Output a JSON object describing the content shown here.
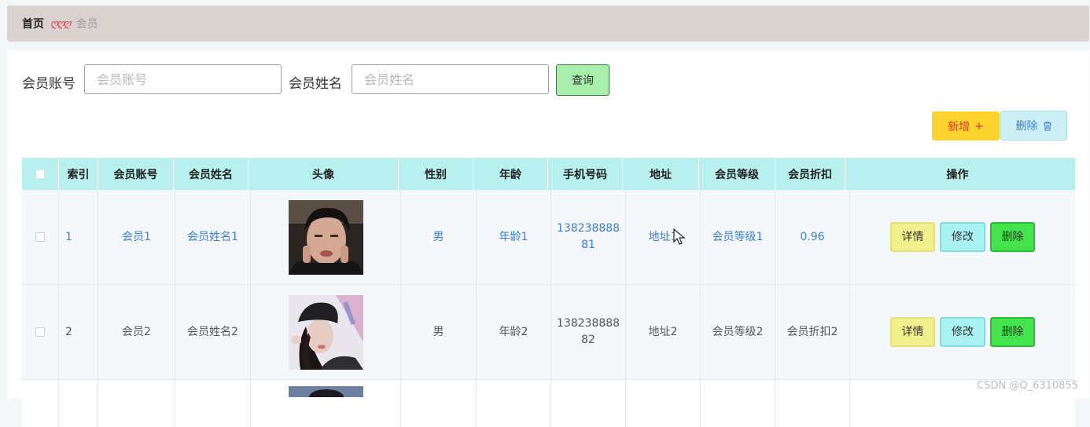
{
  "breadcrumb": {
    "home": "首页",
    "separator": "ღღღ",
    "current": "会员"
  },
  "search": {
    "account_label": "会员账号",
    "account_placeholder": "会员账号",
    "name_label": "会员姓名",
    "name_placeholder": "会员姓名",
    "query_label": "查询"
  },
  "toolbar": {
    "add_label": "新增",
    "add_icon": "+",
    "delete_label": "删除",
    "delete_icon": "trash-icon"
  },
  "table": {
    "headers": [
      "索引",
      "会员账号",
      "会员姓名",
      "头像",
      "性别",
      "年龄",
      "手机号码",
      "地址",
      "会员等级",
      "会员折扣",
      "操作"
    ],
    "rows": [
      {
        "index": "1",
        "account": "会员1",
        "name": "会员姓名1",
        "gender": "男",
        "age": "年龄1",
        "phone_line1": "138238888",
        "phone_line2": "81",
        "address": "地址1",
        "level": "会员等级1",
        "discount": "0.96"
      },
      {
        "index": "2",
        "account": "会员2",
        "name": "会员姓名2",
        "gender": "男",
        "age": "年龄2",
        "phone_line1": "138238888",
        "phone_line2": "82",
        "address": "地址2",
        "level": "会员等级2",
        "discount": "会员折扣2"
      }
    ],
    "actions": {
      "detail": "详情",
      "edit": "修改",
      "delete": "删除"
    }
  },
  "watermark": "CSDN @Q_6310855",
  "colors": {
    "header_bg": "#b7f0ee",
    "link_blue": "#3b7fd3",
    "add_btn": "#fdd32f",
    "delete_btn": "#45e34e"
  }
}
